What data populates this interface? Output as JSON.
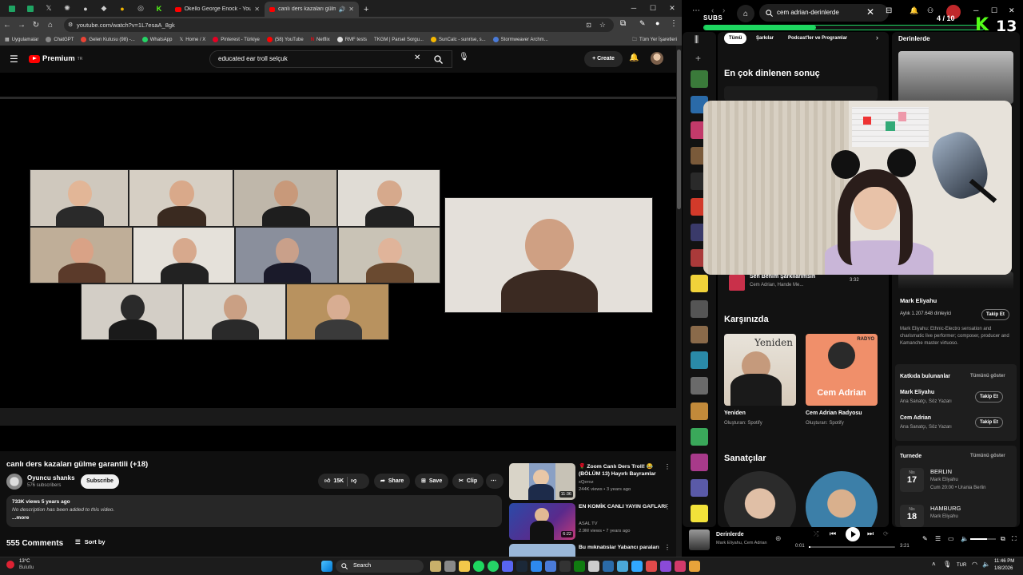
{
  "chrome": {
    "tabs": [
      {
        "label": "Okello George Enock - YouTube"
      },
      {
        "label": "canlı ders kazaları gülme ga..."
      }
    ],
    "url": "youtube.com/watch?v=1L7esaA_8gk",
    "bookmarks": [
      "Uygulamalar",
      "ChatGPT",
      "Gelen Kutusu (98) -...",
      "WhatsApp",
      "Home / X",
      "Pinterest - Türkiye",
      "(58) YouTube",
      "Netflix",
      "RMF tests",
      "TKGM | Parsel Sorgu...",
      "SunCalc - sunrise, s...",
      "Stormweaver Archm..."
    ],
    "all_bookmarks": "Tüm Yer İşaretleri"
  },
  "youtube": {
    "logo": "Premium",
    "logo_region": "TR",
    "search_value": "educated ear troll selçuk",
    "create_label": "Create",
    "video": {
      "title": "canlı ders kazaları gülme garantili (+18)",
      "channel": "Oyuncu shanks",
      "subscribers": "576 subscribers",
      "subscribe_label": "Subscribe",
      "likes": "15K",
      "share_label": "Share",
      "save_label": "Save",
      "clip_label": "Clip",
      "views_time": "733K views  5 years ago",
      "description": "No description has been added to this video.",
      "more_label": "...more",
      "comments": "555 Comments",
      "sort_label": "Sort by"
    },
    "recommendations": [
      {
        "title": "🌹 Zoom Canlı Ders Troll! 😂 (BÖLÜM 13) Hayırlı Bayramlar",
        "channel": "xQeroz",
        "views": "244K views • 3 years ago",
        "duration": "11:36"
      },
      {
        "title": "EN KOMİK CANLI YAYIN GAFLARI",
        "channel": "ASAL TV",
        "views": "2.9M views • 7 years ago",
        "duration": "6:22"
      },
      {
        "title": "Bu mıknatıslar Yabancı paraları",
        "channel": "",
        "views": "",
        "duration": ""
      }
    ]
  },
  "spotify": {
    "search_value": "cem adrian-derinlerde",
    "chips": [
      "Tümü",
      "Şarkılar",
      "Podcast'ler ve Programlar"
    ],
    "top_result_heading": "En çok dinlenen sonuç",
    "song": {
      "title": "Sen Benim Şarkılarımsın",
      "artists": "Cem Adrian, Hande Me...",
      "duration": "3:32"
    },
    "featuring_heading": "Karşınızda",
    "cards": [
      {
        "title": "Yeniden",
        "sub": "Oluşturan: Spotify",
        "cover_text": "Yeniden"
      },
      {
        "title": "Cem Adrian Radyosu",
        "sub": "Oluşturan: Spotify",
        "cover_text": "Cem Adrian",
        "badge": "RADYO"
      }
    ],
    "artists_heading": "Sanatçılar",
    "right_panel": {
      "title": "Derinlerde",
      "artist": "Mark Eliyahu",
      "listeners": "Aylık 1.207.648 dinleyici",
      "follow_label": "Takip Et",
      "bio": "Mark Eliyahu: Ethnic-Electro sensation and charismatic live performer; composer, producer and Kamanche master virtuoso.",
      "credits_heading": "Katkıda bulunanlar",
      "show_all": "Tümünü göster",
      "credits": [
        {
          "name": "Mark Eliyahu",
          "role": "Ana Sanatçı, Söz Yazarı"
        },
        {
          "name": "Cem Adrian",
          "role": "Ana Sanatçı, Söz Yazarı"
        }
      ],
      "tour_heading": "Turnede",
      "tour": [
        {
          "city": "BERLIN",
          "month": "Nis",
          "day": "17",
          "artist": "Mark Eliyahu",
          "venue": "Cum 20:00 • Urania Berlin"
        },
        {
          "city": "HAMBURG",
          "month": "Nis",
          "day": "18",
          "artist": "Mark Eliyahu",
          "venue": ""
        }
      ]
    },
    "now_playing": {
      "title": "Derinlerde",
      "artists": "Mark Eliyahu, Cem Adrian",
      "elapsed": "0:01",
      "total": "3:21",
      "progress": 0.005
    }
  },
  "overlay": {
    "subs_label": "SUBS",
    "subs_count": "4 / 10",
    "subs_progress": 0.4,
    "k_label": "K",
    "k_count": "13"
  },
  "taskbar": {
    "weather_temp": "13°C",
    "weather_desc": "Bulutlu",
    "search_placeholder": "Search",
    "lang": "TUR",
    "time": "11:46 PM",
    "date": "1/8/2026"
  }
}
